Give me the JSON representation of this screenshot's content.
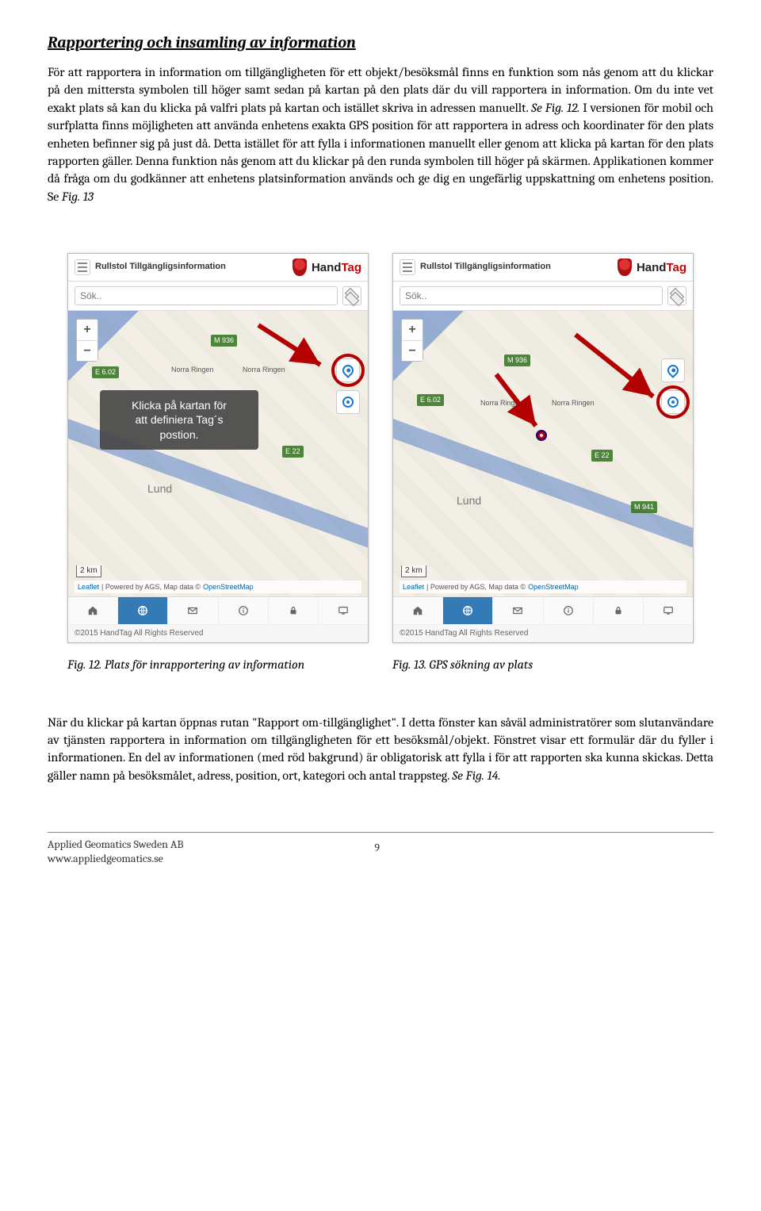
{
  "heading": "Rapportering och insamling av information",
  "para1": "För att rapportera in information om tillgängligheten för ett objekt/besöksmål finns en funktion som nås genom att du klickar på den mittersta symbolen till höger samt sedan på kartan på den plats där du vill rapportera in information. Om du inte vet exakt plats så kan du klicka på valfri plats på kartan och istället skriva in adressen manuellt. ",
  "para1_ref": "Se Fig. 12.",
  "para1b": " I versionen för mobil och surfplatta finns möjligheten att använda enhetens exakta GPS position för att rapportera in adress och koordinater för den plats enheten befinner sig på just då. Detta istället för att fylla i informationen manuellt eller genom att klicka på kartan för den plats rapporten gäller. Denna funktion nås genom att du klickar på den runda symbolen till höger på skärmen. Applikationen kommer då fråga om du godkänner att enhetens platsinformation används och ge dig en ungefärlig uppskattning om enhetens position. Se ",
  "para1_ref2": "Fig. 13",
  "app": {
    "top_title": "Rullstol Tillgängligsinformation",
    "brand1": "Hand",
    "brand2": "Tag",
    "search_placeholder": "Sök..",
    "tooltip_l1": "Klicka på kartan för",
    "tooltip_l2": "att definiera Tag´s",
    "tooltip_l3": "postion.",
    "scale": "2 km",
    "attrib_leaflet": "Leaflet",
    "attrib_mid": " | Powered by AGS, Map data © ",
    "attrib_osm": "OpenStreetMap",
    "road_m936": "M 936",
    "road_e602": "E 6.02",
    "road_e22": "E 22",
    "road_m941": "M 941",
    "label_norra": "Norra Ringen",
    "city_lund": "Lund",
    "copyright": "©2015 HandTag All Rights Reserved"
  },
  "caption_left": "Fig. 12. Plats för inrapportering av information",
  "caption_right": "Fig. 13. GPS sökning av plats",
  "para2": "När du klickar på kartan öppnas rutan \"Rapport om-tillgänglighet\". I detta fönster kan såväl administratörer som slutanvändare av tjänsten rapportera in information om tillgängligheten för ett besöksmål/objekt. Fönstret visar ett formulär där du fyller i informationen. En del av informationen (med röd bakgrund) är obligatorisk att fylla i för att rapporten ska kunna skickas. Detta gäller namn på besöksmålet, adress, position, ort, kategori och antal trappsteg. ",
  "para2_ref": "Se Fig. 14.",
  "footer": {
    "company": "Applied Geomatics Sweden AB",
    "url": "www.appliedgeomatics.se",
    "page": "9"
  }
}
